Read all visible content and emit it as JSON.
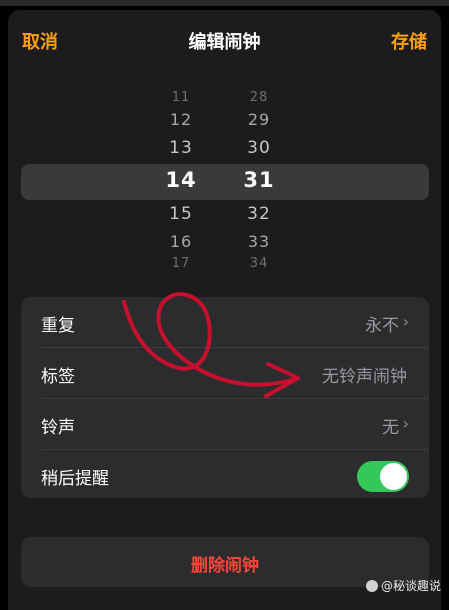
{
  "nav": {
    "cancel": "取消",
    "title": "编辑闹钟",
    "save": "存储"
  },
  "picker": {
    "hours": [
      "11",
      "12",
      "13",
      "14",
      "15",
      "16",
      "17"
    ],
    "minutes": [
      "28",
      "29",
      "30",
      "31",
      "32",
      "33",
      "34"
    ],
    "selected_hour": "14",
    "selected_minute": "31"
  },
  "settings": {
    "repeat": {
      "label": "重复",
      "value": "永不"
    },
    "label": {
      "label": "标签",
      "value": "无铃声闹钟"
    },
    "sound": {
      "label": "铃声",
      "value": "无"
    },
    "snooze": {
      "label": "稍后提醒",
      "on": true
    }
  },
  "delete_label": "删除闹钟",
  "watermark": "@秘谈趣说",
  "colors": {
    "accent": "#ff9f0a",
    "destructive": "#ff453a",
    "toggle_on": "#34c759",
    "annotation": "#c8102e"
  }
}
